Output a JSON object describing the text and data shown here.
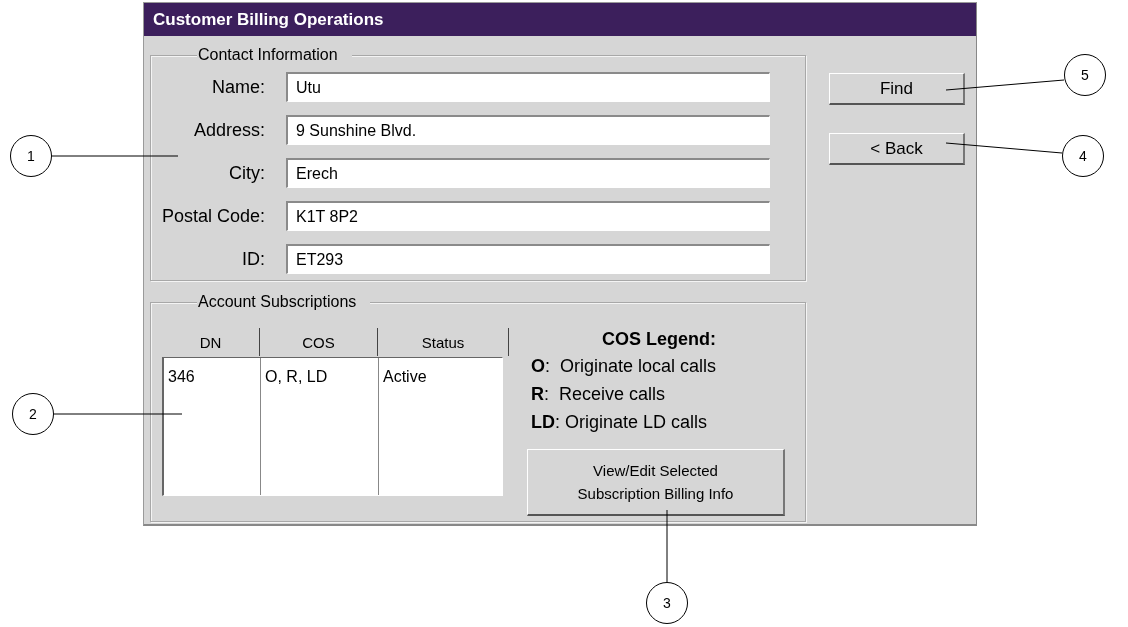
{
  "window": {
    "title": "Customer Billing Operations"
  },
  "contact": {
    "legend": "Contact Information",
    "fields": [
      {
        "label": "Name:",
        "value": "Utu"
      },
      {
        "label": "Address:",
        "value": "9 Sunshine Blvd."
      },
      {
        "label": "City:",
        "value": "Erech"
      },
      {
        "label": "Postal Code:",
        "value": "K1T 8P2"
      },
      {
        "label": "ID:",
        "value": "ET293"
      }
    ]
  },
  "buttons": [
    {
      "label": "Find"
    },
    {
      "label": "< Back"
    }
  ],
  "subscriptions": {
    "legend": "Account Subscriptions",
    "columns": [
      "DN",
      "COS",
      "Status"
    ],
    "rows": [
      [
        "346",
        "O, R, LD",
        "Active"
      ]
    ],
    "cos_legend": {
      "title": "COS Legend:",
      "items": [
        "**O**:  Originate local calls",
        "**R**:  Receive calls",
        "**LD**: Originate LD calls"
      ]
    },
    "action_button": {
      "lines": [
        "View/Edit Selected",
        "Subscription Billing Info"
      ]
    }
  },
  "callouts": [
    "1",
    "2",
    "3",
    "4",
    "5"
  ]
}
